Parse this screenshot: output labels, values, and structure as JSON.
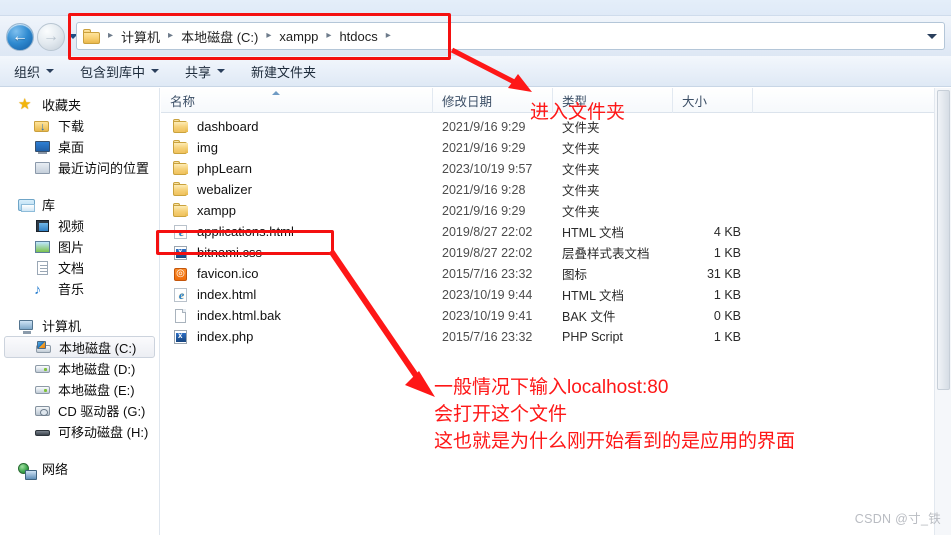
{
  "window": {
    "nav": {
      "back_label": "后退",
      "forward_label": "前进",
      "recent_dropdown_label": "最近浏览的位置"
    },
    "address": {
      "folder_icon": "folder-icon",
      "crumbs": [
        "计算机",
        "本地磁盘 (C:)",
        "xampp",
        "htdocs"
      ],
      "separator": "▸",
      "dropdown_icon": "chevron-down-icon"
    },
    "toolbar": {
      "items": [
        {
          "label": "组织",
          "has_caret": true
        },
        {
          "label": "包含到库中",
          "has_caret": true
        },
        {
          "label": "共享",
          "has_caret": true
        },
        {
          "label": "新建文件夹",
          "has_caret": false
        }
      ]
    }
  },
  "sidebar": {
    "groups": [
      {
        "root": {
          "label": "收藏夹",
          "icon": "star-icon"
        },
        "children": [
          {
            "label": "下载",
            "icon": "download-folder-icon"
          },
          {
            "label": "桌面",
            "icon": "desktop-icon"
          },
          {
            "label": "最近访问的位置",
            "icon": "recent-places-icon"
          }
        ]
      },
      {
        "root": {
          "label": "库",
          "icon": "library-icon"
        },
        "children": [
          {
            "label": "视频",
            "icon": "video-icon"
          },
          {
            "label": "图片",
            "icon": "pictures-icon"
          },
          {
            "label": "文档",
            "icon": "documents-icon"
          },
          {
            "label": "音乐",
            "icon": "music-icon"
          }
        ]
      },
      {
        "root": {
          "label": "计算机",
          "icon": "computer-icon"
        },
        "children": [
          {
            "label": "本地磁盘 (C:)",
            "icon": "system-drive-icon",
            "selected": true
          },
          {
            "label": "本地磁盘 (D:)",
            "icon": "hard-drive-icon",
            "selected": false
          },
          {
            "label": "本地磁盘 (E:)",
            "icon": "hard-drive-icon",
            "selected": false
          },
          {
            "label": "CD 驱动器 (G:)",
            "icon": "cd-drive-icon",
            "selected": false
          },
          {
            "label": "可移动磁盘 (H:)",
            "icon": "removable-drive-icon",
            "selected": false
          }
        ]
      },
      {
        "root": {
          "label": "网络",
          "icon": "network-icon"
        },
        "children": []
      }
    ]
  },
  "filelist": {
    "columns": [
      "名称",
      "修改日期",
      "类型",
      "大小"
    ],
    "sort_column": "名称",
    "sort_direction": "ascending",
    "rows": [
      {
        "name": "dashboard",
        "date": "2021/9/16 9:29",
        "type": "文件夹",
        "size": "",
        "icon": "folder-icon"
      },
      {
        "name": "img",
        "date": "2021/9/16 9:29",
        "type": "文件夹",
        "size": "",
        "icon": "folder-icon"
      },
      {
        "name": "phpLearn",
        "date": "2023/10/19 9:57",
        "type": "文件夹",
        "size": "",
        "icon": "folder-icon"
      },
      {
        "name": "webalizer",
        "date": "2021/9/16 9:28",
        "type": "文件夹",
        "size": "",
        "icon": "folder-icon"
      },
      {
        "name": "xampp",
        "date": "2021/9/16 9:29",
        "type": "文件夹",
        "size": "",
        "icon": "folder-icon"
      },
      {
        "name": "applications.html",
        "date": "2019/8/27 22:02",
        "type": "HTML 文档",
        "size": "4 KB",
        "icon": "ie-html-icon"
      },
      {
        "name": "bitnami.css",
        "date": "2019/8/27 22:02",
        "type": "层叠样式表文档",
        "size": "1 KB",
        "icon": "css-file-icon"
      },
      {
        "name": "favicon.ico",
        "date": "2015/7/16 23:32",
        "type": "图标",
        "size": "31 KB",
        "icon": "favicon-icon"
      },
      {
        "name": "index.html",
        "date": "2023/10/19 9:44",
        "type": "HTML 文档",
        "size": "1 KB",
        "icon": "ie-html-icon"
      },
      {
        "name": "index.html.bak",
        "date": "2023/10/19 9:41",
        "type": "BAK 文件",
        "size": "0 KB",
        "icon": "generic-file-icon"
      },
      {
        "name": "index.php",
        "date": "2015/7/16 23:32",
        "type": "PHP Script",
        "size": "1 KB",
        "icon": "php-file-icon"
      }
    ]
  },
  "annotations": {
    "enter_folder": "进入文件夹",
    "line1": "一般情况下输入localhost:80",
    "line2": "会打开这个文件",
    "line3": "这也就是为什么刚开始看到的是应用的界面",
    "color": "#fe1717"
  },
  "watermark": {
    "text": "CSDN @寸_铁"
  }
}
